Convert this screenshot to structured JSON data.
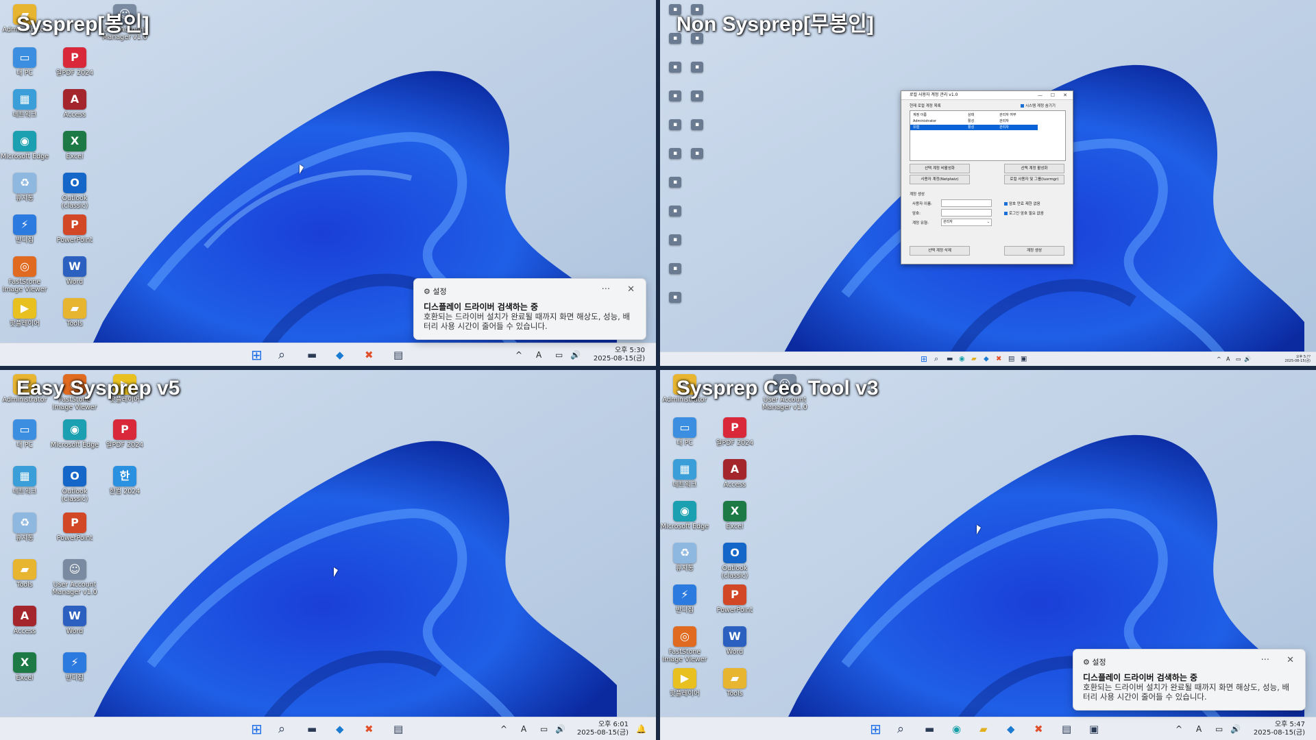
{
  "panels": {
    "tl": {
      "title": "Sysprep[봉인]",
      "icons": [
        "Administrator",
        "User Account Manager v1.0",
        "내 PC",
        "알PDF 2024",
        "네트워크",
        "Access",
        "Microsoft Edge",
        "Excel",
        "휴지통",
        "Outlook (classic)",
        "반디집",
        "PowerPoint",
        "FastStone Image Viewer",
        "Word",
        "팟플레이어",
        "Tools"
      ],
      "clock_time": "오후 5:30",
      "clock_date": "2025-08-15(금)"
    },
    "tr": {
      "title": "Non Sysprep[무봉인]",
      "clock_time": "오후 5:??",
      "clock_date": "2025-08-15(금)"
    },
    "bl": {
      "title": "Easy Sysprep v5",
      "icons": [
        "Administrator",
        "FastStone Image Viewer",
        "팟플레이어",
        "내 PC",
        "Microsoft Edge",
        "알PDF 2024",
        "네트워크",
        "Outlook (classic)",
        "한컴 2024",
        "휴지통",
        "PowerPoint",
        "Tools",
        "User Account Manager v1.0",
        "Access",
        "Word",
        "Excel",
        "반디집"
      ],
      "clock_time": "오후 6:01",
      "clock_date": "2025-08-15(금)"
    },
    "br": {
      "title": "Sysprep Ceo Tool v3",
      "icons": [
        "Administrator",
        "User Account Manager v1.0",
        "내 PC",
        "알PDF 2024",
        "네트워크",
        "Access",
        "Microsoft Edge",
        "Excel",
        "휴지통",
        "Outlook (classic)",
        "반디집",
        "PowerPoint",
        "FastStone Image Viewer",
        "Word",
        "팟플레이어",
        "Tools"
      ],
      "clock_time": "오후 5:47",
      "clock_date": "2025-08-15(금)"
    }
  },
  "toast": {
    "app": "설정",
    "more": "···",
    "close": "✕",
    "title": "디스플레이 드라이버 검색하는 중",
    "body": "호환되는 드라이버 설치가 완료될 때까지 화면 해상도, 성능, 배터리 사용 시간이 줄어들 수 있습니다."
  },
  "dialog": {
    "title": "로컬 사용자 계정 관리 v1.0",
    "list_group": "현재 로컬 계정 목록",
    "show_system": "시스템 계정 숨기기",
    "col_name": "계정 이름",
    "col_status": "상태",
    "col_admin": "관리자 여부",
    "rows": [
      {
        "name": "Administrator",
        "status": "활성",
        "admin": "관리자"
      },
      {
        "name": "유협",
        "status": "활성",
        "admin": "관리자"
      }
    ],
    "btn_disable": "선택 계정 비활성화",
    "btn_enable": "선택 계정 활성화",
    "btn_netplwiz": "사용자 계정(Netplwiz)",
    "btn_lusrmgr": "로컬 사용자 및 그룹(lusrmgr)",
    "create_group": "계정 생성",
    "label_user": "사용자 이름:",
    "label_pw": "암호:",
    "label_type": "계정 유형:",
    "type_value": "관리자",
    "chk_expire": "암호 만료 제한 없음",
    "chk_login": "로그인 암호 필요 없음",
    "btn_delete": "선택 계정 삭제",
    "btn_create": "계정 생성"
  },
  "tray": {
    "chev": "^",
    "ime": "A",
    "net": "▭",
    "vol": "🔊"
  }
}
